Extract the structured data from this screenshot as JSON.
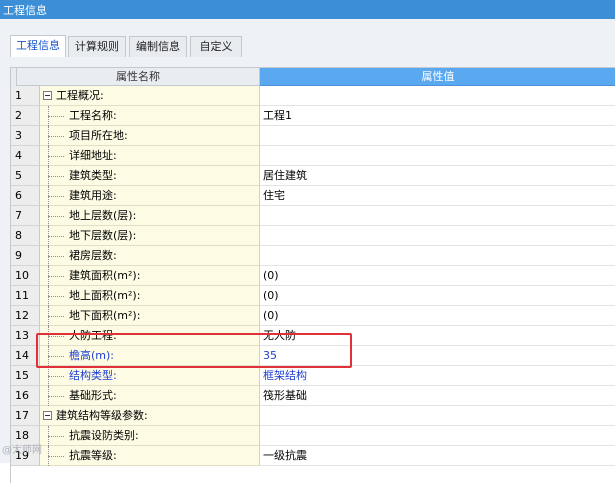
{
  "window": {
    "title": "工程信息"
  },
  "tabs": [
    {
      "label": "工程信息",
      "active": true
    },
    {
      "label": "计算规则",
      "active": false
    },
    {
      "label": "编制信息",
      "active": false
    },
    {
      "label": "自定义",
      "active": false
    }
  ],
  "grid": {
    "header": {
      "name": "属性名称",
      "value": "属性值"
    },
    "rows": [
      {
        "num": "1",
        "name": "工程概况:",
        "value": "",
        "group": true
      },
      {
        "num": "2",
        "name": "工程名称:",
        "value": "工程1"
      },
      {
        "num": "3",
        "name": "项目所在地:",
        "value": ""
      },
      {
        "num": "4",
        "name": "详细地址:",
        "value": ""
      },
      {
        "num": "5",
        "name": "建筑类型:",
        "value": "居住建筑"
      },
      {
        "num": "6",
        "name": "建筑用途:",
        "value": "住宅"
      },
      {
        "num": "7",
        "name": "地上层数(层):",
        "value": ""
      },
      {
        "num": "8",
        "name": "地下层数(层):",
        "value": ""
      },
      {
        "num": "9",
        "name": "裙房层数:",
        "value": ""
      },
      {
        "num": "10",
        "name": "建筑面积(m²):",
        "value": "(0)"
      },
      {
        "num": "11",
        "name": "地上面积(m²):",
        "value": "(0)"
      },
      {
        "num": "12",
        "name": "地下面积(m²):",
        "value": "(0)"
      },
      {
        "num": "13",
        "name": "人防工程:",
        "value": "无人防"
      },
      {
        "num": "14",
        "name": "檐高(m):",
        "value": "35",
        "emphasis": true
      },
      {
        "num": "15",
        "name": "结构类型:",
        "value": "框架结构",
        "emphasis": true
      },
      {
        "num": "16",
        "name": "基础形式:",
        "value": "筏形基础"
      },
      {
        "num": "17",
        "name": "建筑结构等级参数:",
        "value": "",
        "group": true
      },
      {
        "num": "18",
        "name": "抗震设防类别:",
        "value": ""
      },
      {
        "num": "19",
        "name": "抗震等级:",
        "value": "一级抗震"
      }
    ]
  },
  "watermark": {
    "text": "@大师网"
  },
  "colors": {
    "titlebar": "#3c8fd6",
    "value_header": "#5aa8f0",
    "name_column": "#fdfbe4",
    "highlight": "#e0303a",
    "emphasis_text": "#1f3fd1"
  }
}
